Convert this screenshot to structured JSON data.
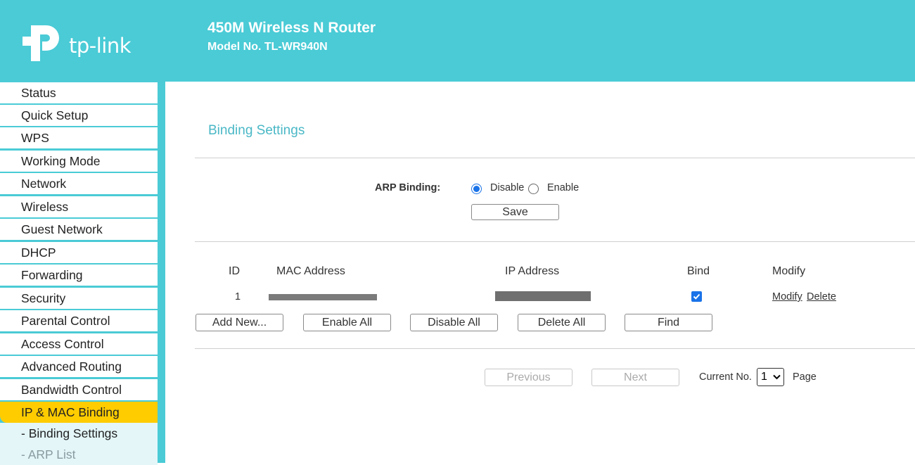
{
  "header": {
    "brand": "tp-link",
    "router_name": "450M Wireless N Router",
    "model": "Model No. TL-WR940N"
  },
  "sidebar": {
    "items": [
      {
        "label": "Status"
      },
      {
        "label": "Quick Setup"
      },
      {
        "label": "WPS"
      },
      {
        "label": "Working Mode"
      },
      {
        "label": "Network"
      },
      {
        "label": "Wireless"
      },
      {
        "label": "Guest Network"
      },
      {
        "label": "DHCP"
      },
      {
        "label": "Forwarding"
      },
      {
        "label": "Security"
      },
      {
        "label": "Parental Control"
      },
      {
        "label": "Access Control"
      },
      {
        "label": "Advanced Routing"
      },
      {
        "label": "Bandwidth Control"
      },
      {
        "label": "IP & MAC Binding",
        "active": true
      }
    ],
    "sub_items": [
      {
        "label": "- Binding Settings",
        "active": true
      },
      {
        "label": "- ARP List"
      }
    ]
  },
  "main": {
    "title": "Binding Settings",
    "arp_binding_label": "ARP Binding:",
    "radio_disable": "Disable",
    "radio_enable": "Enable",
    "arp_binding_value": "Disable",
    "save_label": "Save",
    "table": {
      "headers": [
        "ID",
        "MAC Address",
        "IP Address",
        "Bind",
        "Modify"
      ],
      "rows": [
        {
          "id": "1",
          "bind": true,
          "modify": "Modify",
          "delete": "Delete"
        }
      ]
    },
    "buttons": {
      "add_new": "Add New...",
      "enable_all": "Enable All",
      "disable_all": "Disable All",
      "delete_all": "Delete All",
      "find": "Find"
    },
    "pager": {
      "previous": "Previous",
      "next": "Next",
      "current_label": "Current No.",
      "current_value": "1",
      "page_label": "Page"
    }
  },
  "colors": {
    "header_bg": "#4acbd6",
    "active_menu": "#ffcc00",
    "title_color": "#4ab8c6",
    "check_blue": "#1a73e8"
  }
}
